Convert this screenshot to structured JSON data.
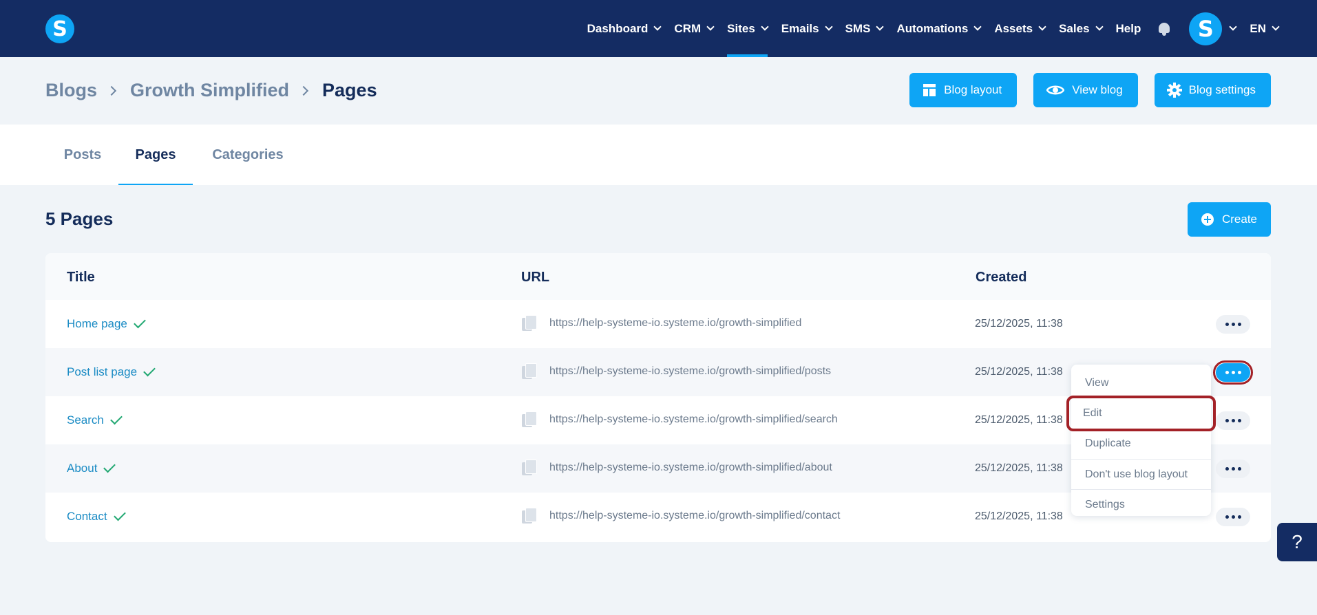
{
  "nav": {
    "logo": "S",
    "items": [
      {
        "label": "Dashboard"
      },
      {
        "label": "CRM"
      },
      {
        "label": "Sites"
      },
      {
        "label": "Emails"
      },
      {
        "label": "SMS"
      },
      {
        "label": "Automations"
      },
      {
        "label": "Assets"
      },
      {
        "label": "Sales"
      }
    ],
    "help": "Help",
    "avatar": "S",
    "lang": "EN"
  },
  "breadcrumb": [
    "Blogs",
    "Growth Simplified",
    "Pages"
  ],
  "actions": {
    "blog_layout": "Blog layout",
    "view_blog": "View blog",
    "blog_settings": "Blog settings"
  },
  "tabs": [
    "Posts",
    "Pages",
    "Categories"
  ],
  "section": {
    "title": "5 Pages",
    "create": "Create"
  },
  "table": {
    "columns": [
      "Title",
      "URL",
      "Created"
    ],
    "rows": [
      {
        "title": "Home page",
        "url": "https://help-systeme-io.systeme.io/growth-simplified",
        "created": "25/12/2025, 11:38"
      },
      {
        "title": "Post list page",
        "url": "https://help-systeme-io.systeme.io/growth-simplified/posts",
        "created": "25/12/2025, 11:38"
      },
      {
        "title": "Search",
        "url": "https://help-systeme-io.systeme.io/growth-simplified/search",
        "created": "25/12/2025, 11:38"
      },
      {
        "title": "About",
        "url": "https://help-systeme-io.systeme.io/growth-simplified/about",
        "created": "25/12/2025, 11:38"
      },
      {
        "title": "Contact",
        "url": "https://help-systeme-io.systeme.io/growth-simplified/contact",
        "created": "25/12/2025, 11:38"
      }
    ]
  },
  "dropdown": [
    "View",
    "Edit",
    "Duplicate",
    "Don't use blog layout",
    "Settings"
  ],
  "help_widget": "?"
}
